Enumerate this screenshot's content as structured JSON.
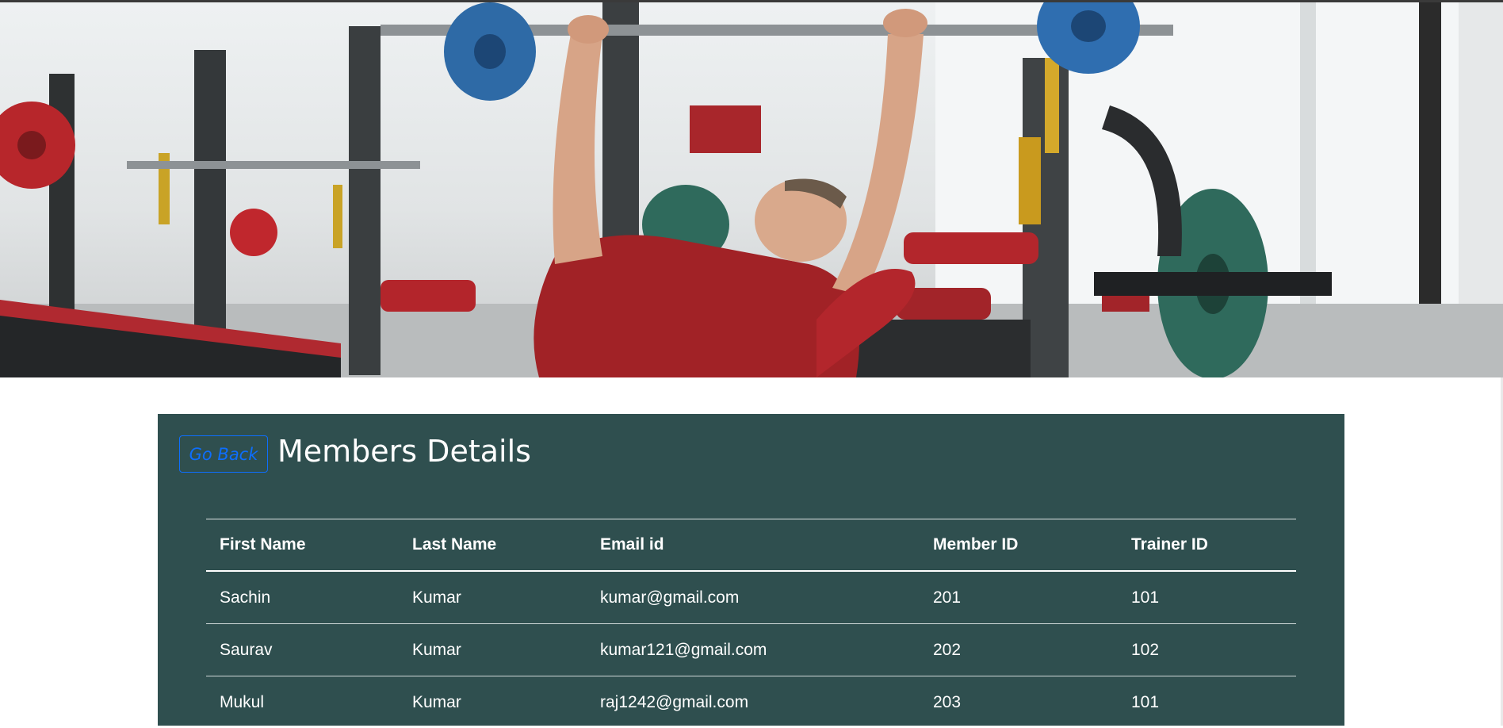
{
  "hero": {
    "description": "gym photo banner"
  },
  "back_button": {
    "label": "Go Back"
  },
  "page_title": "Members Details",
  "table": {
    "columns": [
      "First Name",
      "Last Name",
      "Email id",
      "Member ID",
      "Trainer ID"
    ],
    "rows": [
      [
        "Sachin",
        "Kumar",
        "kumar@gmail.com",
        "201",
        "101"
      ],
      [
        "Saurav",
        "Kumar",
        "kumar121@gmail.com",
        "202",
        "102"
      ],
      [
        "Mukul",
        "Kumar",
        "raj1242@gmail.com",
        "203",
        "101"
      ]
    ]
  },
  "colors": {
    "panel_background": "#2f4f4f",
    "button_accent": "#0d6efd",
    "text": "#ffffff"
  }
}
